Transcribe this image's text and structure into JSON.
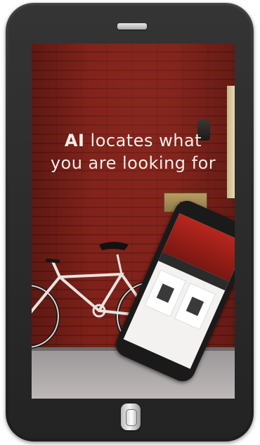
{
  "screen": {
    "headline_strong": "AI",
    "headline_rest_line1": " locates what",
    "headline_line2": "you are looking for"
  },
  "colors": {
    "device_body": "#2a2a2a",
    "wall": "#7e2119",
    "headline_text": "#f3ede8",
    "sidewalk": "#a9a5a5"
  },
  "icons": {
    "speaker": "speaker-grille-icon",
    "home": "home-button-icon"
  }
}
